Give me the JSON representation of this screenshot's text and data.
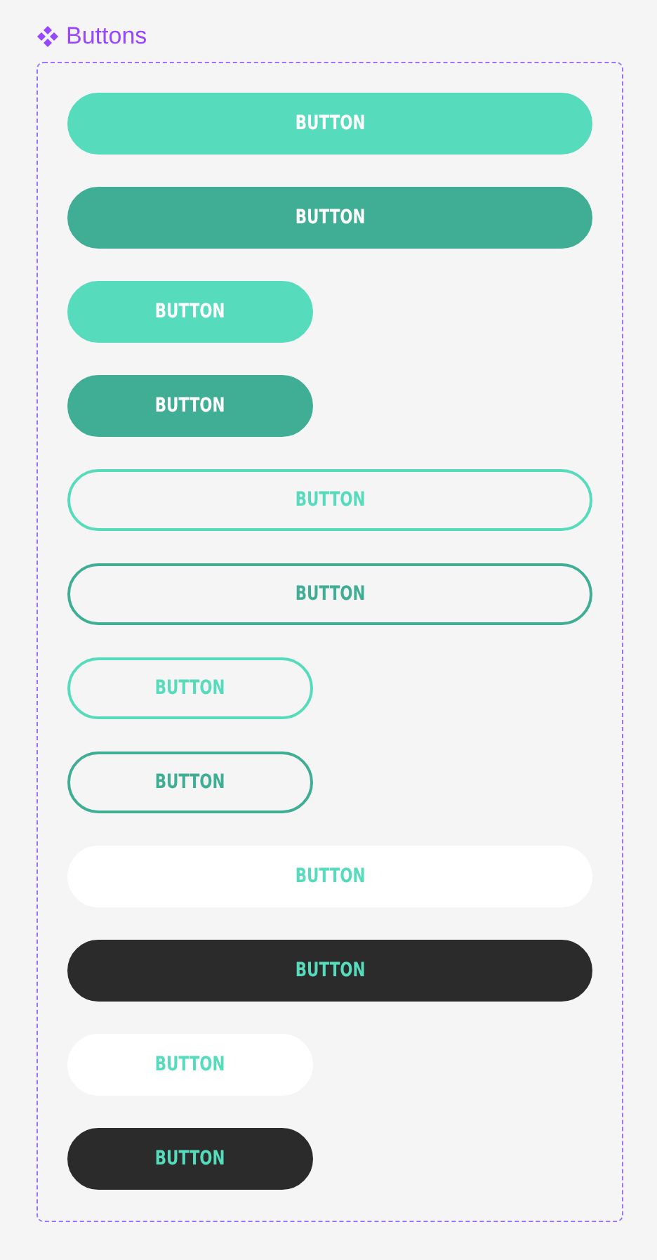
{
  "title": "Buttons",
  "buttons": [
    {
      "label": "BUTTON",
      "kind": "filled_wide",
      "color": "#56dcbc"
    },
    {
      "label": "BUTTON",
      "kind": "filled_wide",
      "color": "#3fae94"
    },
    {
      "label": "BUTTON",
      "kind": "filled_small",
      "color": "#56dcbc"
    },
    {
      "label": "BUTTON",
      "kind": "filled_small",
      "color": "#3fae94"
    },
    {
      "label": "BUTTON",
      "kind": "outline_wide",
      "color": "#56dcbc"
    },
    {
      "label": "BUTTON",
      "kind": "outline_wide",
      "color": "#3fae94"
    },
    {
      "label": "BUTTON",
      "kind": "outline_small",
      "color": "#56dcbc"
    },
    {
      "label": "BUTTON",
      "kind": "outline_small",
      "color": "#3fae94"
    },
    {
      "label": "BUTTON",
      "kind": "solid_wide",
      "color": "#ffffff"
    },
    {
      "label": "BUTTON",
      "kind": "solid_wide",
      "color": "#2b2b2b"
    },
    {
      "label": "BUTTON",
      "kind": "solid_small",
      "color": "#ffffff"
    },
    {
      "label": "BUTTON",
      "kind": "solid_small",
      "color": "#2b2b2b"
    }
  ]
}
